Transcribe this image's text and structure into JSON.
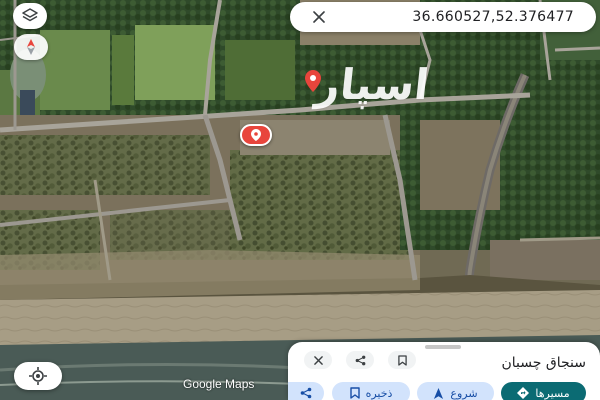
{
  "search": {
    "query": "36.660527,52.376477"
  },
  "map": {
    "attribution": "Google Maps",
    "watermark_text": "اسپار",
    "compass_icon": "compass-icon",
    "layers_icon": "layers-icon",
    "location_icon": "my-location-icon"
  },
  "place": {
    "name": "سنجاق چسبان"
  },
  "actions": [
    {
      "label": "مسیرها",
      "icon": "directions-icon"
    },
    {
      "label": "شروع",
      "icon": "navigation-icon"
    },
    {
      "label": "ذخیره",
      "icon": "bookmark-icon"
    },
    {
      "label": "",
      "icon": "share-icon"
    }
  ],
  "colors": {
    "accent": "#0b6b73",
    "chip_bg": "#d2e3fc",
    "pin": "#e8453c"
  }
}
